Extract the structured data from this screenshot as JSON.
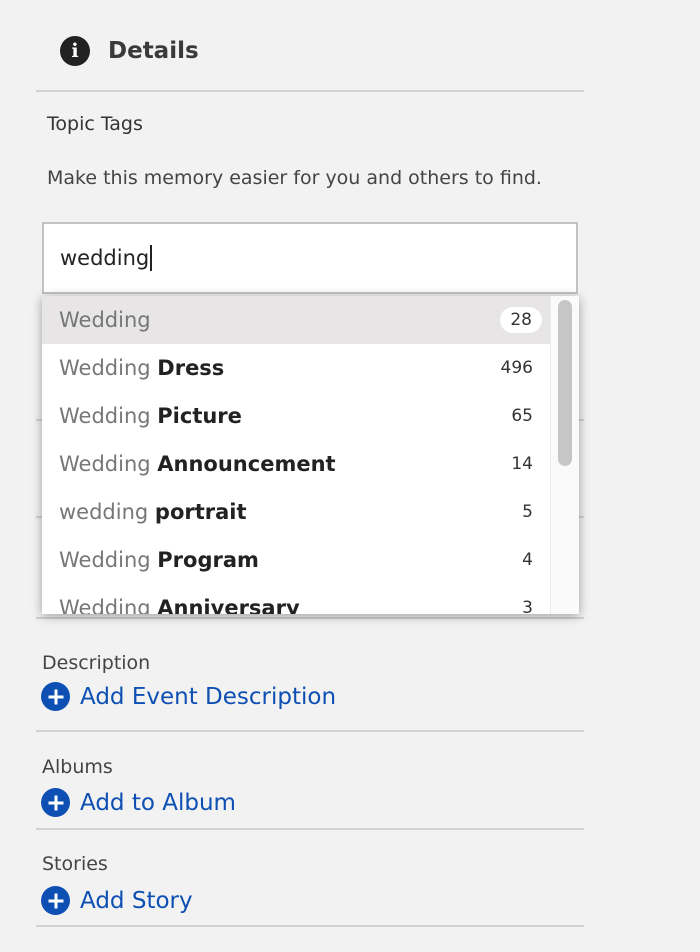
{
  "header": {
    "title": "Details",
    "icon": "info-icon"
  },
  "topic_tags": {
    "label": "Topic Tags",
    "help_text": "Make this memory easier for you and others to find.",
    "input_value": "wedding"
  },
  "suggestions": [
    {
      "match": "Wedding",
      "rest": "",
      "count": "28",
      "highlighted": true
    },
    {
      "match": "Wedding",
      "rest": "Dress",
      "count": "496"
    },
    {
      "match": "Wedding",
      "rest": "Picture",
      "count": "65"
    },
    {
      "match": "Wedding",
      "rest": "Announcement",
      "count": "14"
    },
    {
      "match": "wedding",
      "rest": "portrait",
      "count": "5"
    },
    {
      "match": "Wedding",
      "rest": "Program",
      "count": "4"
    },
    {
      "match": "Wedding",
      "rest": "Anniversary",
      "count": "3"
    }
  ],
  "description": {
    "label": "Description",
    "link": "Add Event Description"
  },
  "albums": {
    "label": "Albums",
    "link": "Add to Album"
  },
  "stories": {
    "label": "Stories",
    "link": "Add Story"
  },
  "colors": {
    "accent": "#0d4fb3",
    "highlight": "#e7e5e5",
    "background": "#f2f2f2"
  }
}
